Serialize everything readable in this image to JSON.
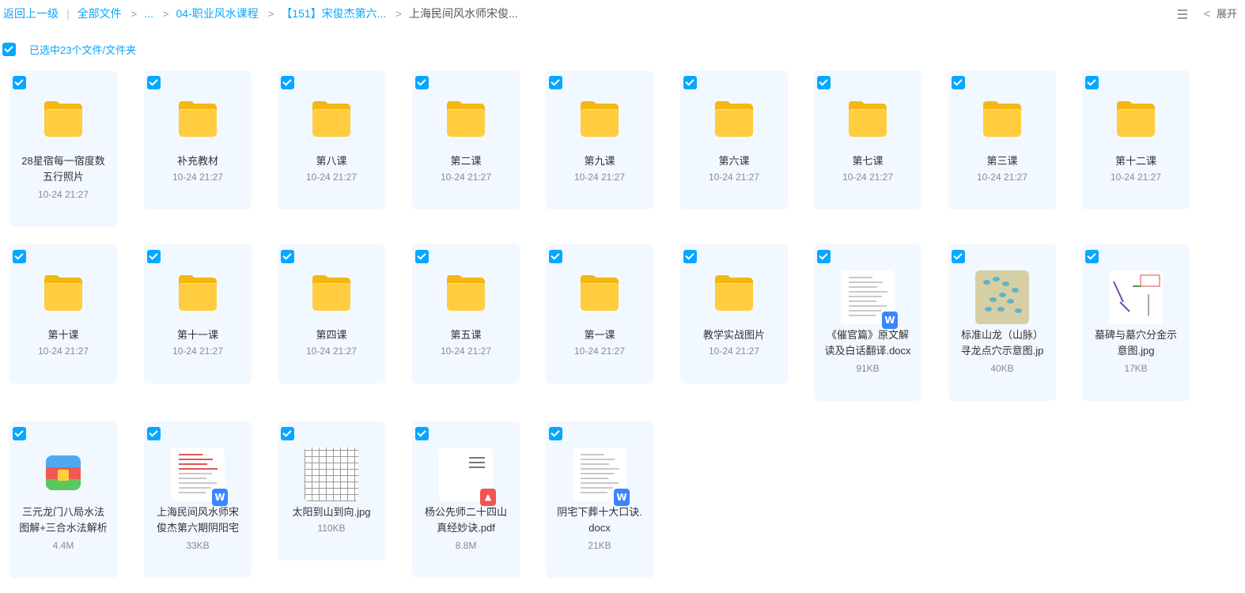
{
  "breadcrumb": {
    "back": "返回上一级",
    "items": [
      "全部文件",
      "...",
      "04-职业风水课程",
      "【151】宋俊杰第六...",
      "上海民间风水师宋俊..."
    ]
  },
  "toolbar": {
    "expand_label": "展开"
  },
  "selection": {
    "text": "已选中23个文件/文件夹"
  },
  "files": [
    {
      "name": "28星宿每一宿度数\n五行照片",
      "meta": "10-24 21:27",
      "kind": "folder"
    },
    {
      "name": "补充教材",
      "meta": "10-24 21:27",
      "kind": "folder"
    },
    {
      "name": "第八课",
      "meta": "10-24 21:27",
      "kind": "folder"
    },
    {
      "name": "第二课",
      "meta": "10-24 21:27",
      "kind": "folder"
    },
    {
      "name": "第九课",
      "meta": "10-24 21:27",
      "kind": "folder"
    },
    {
      "name": "第六课",
      "meta": "10-24 21:27",
      "kind": "folder"
    },
    {
      "name": "第七课",
      "meta": "10-24 21:27",
      "kind": "folder"
    },
    {
      "name": "第三课",
      "meta": "10-24 21:27",
      "kind": "folder"
    },
    {
      "name": "第十二课",
      "meta": "10-24 21:27",
      "kind": "folder"
    },
    {
      "name": "第十课",
      "meta": "10-24 21:27",
      "kind": "folder"
    },
    {
      "name": "第十一课",
      "meta": "10-24 21:27",
      "kind": "folder"
    },
    {
      "name": "第四课",
      "meta": "10-24 21:27",
      "kind": "folder"
    },
    {
      "name": "第五课",
      "meta": "10-24 21:27",
      "kind": "folder"
    },
    {
      "name": "第一课",
      "meta": "10-24 21:27",
      "kind": "folder"
    },
    {
      "name": "教学实战图片",
      "meta": "10-24 21:27",
      "kind": "folder"
    },
    {
      "name": "《催官篇》原文解\n读及白话翻译.docx",
      "meta": "91KB",
      "kind": "docx"
    },
    {
      "name": "标准山龙（山脉）\n寻龙点穴示意图.jp",
      "meta": "40KB",
      "kind": "image-mountain"
    },
    {
      "name": "墓碑与墓穴分金示\n意图.jpg",
      "meta": "17KB",
      "kind": "image-diagram"
    },
    {
      "name": "三元龙门八局水法\n图解+三合水法解析",
      "meta": "4.4M",
      "kind": "archive"
    },
    {
      "name": "上海民间风水师宋\n俊杰第六期阴阳宅",
      "meta": "33KB",
      "kind": "docx-red"
    },
    {
      "name": "太阳到山到向.jpg",
      "meta": "110KB",
      "kind": "image-table"
    },
    {
      "name": "杨公先师二十四山\n真经妙诀.pdf",
      "meta": "8.8M",
      "kind": "pdf"
    },
    {
      "name": "阴宅下葬十大口诀.\ndocx",
      "meta": "21KB",
      "kind": "docx"
    }
  ]
}
